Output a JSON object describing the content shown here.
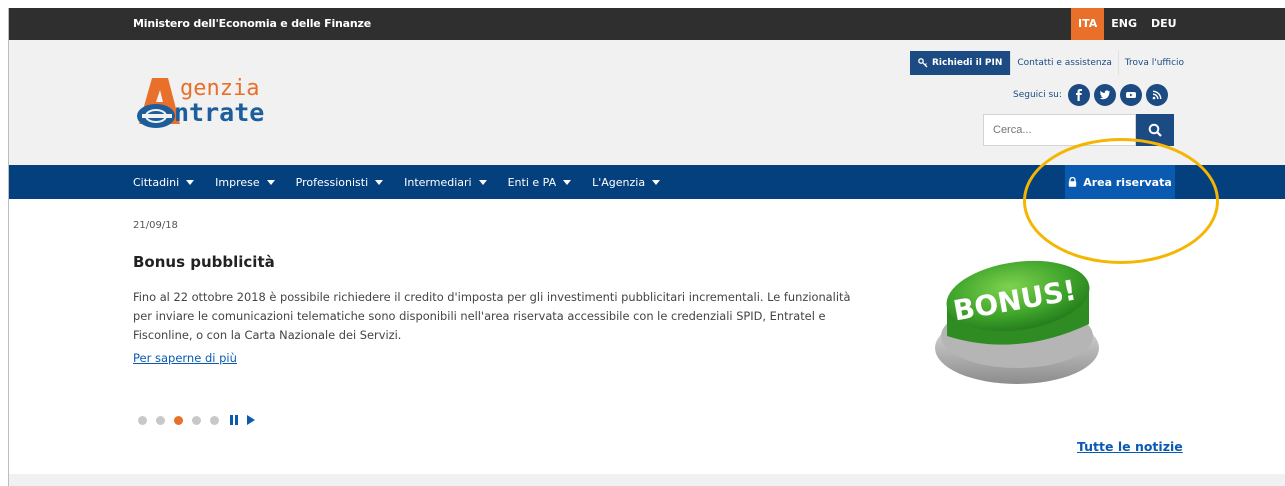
{
  "topbar": {
    "ministry": "Ministero dell'Economia e delle Finanze",
    "languages": [
      {
        "label": "ITA",
        "active": true
      },
      {
        "label": "ENG",
        "active": false
      },
      {
        "label": "DEU",
        "active": false
      }
    ]
  },
  "logo": {
    "line1": "genzia",
    "line2": "ntrate"
  },
  "utility": {
    "pin_label": "Richiedi il PIN",
    "contacts": "Contatti e assistenza",
    "office": "Trova l'ufficio"
  },
  "social": {
    "label": "Seguici su:",
    "icons": [
      "facebook-icon",
      "twitter-icon",
      "youtube-icon",
      "rss-icon"
    ]
  },
  "search": {
    "placeholder": "Cerca..."
  },
  "nav": {
    "items": [
      "Cittadini",
      "Imprese",
      "Professionisti",
      "Intermediari",
      "Enti e PA",
      "L'Agenzia"
    ],
    "area_riservata": "Area riservata"
  },
  "news": {
    "date": "21/09/18",
    "title": "Bonus pubblicità",
    "body": "Fino al 22 ottobre 2018 è possibile richiedere il credito d'imposta per gli investimenti pubblicitari incrementali. Le funzionalità per inviare le comunicazioni telematiche sono disponibili nell'area riservata accessibile con le credenziali SPID, Entratel e Fisconline, o con la Carta Nazionale dei Servizi.",
    "more": "Per saperne di più",
    "image_text": "BONUS!"
  },
  "carousel": {
    "total": 5,
    "active_index": 2
  },
  "footer_link": "Tutte le notizie",
  "colors": {
    "brand_blue": "#05407e",
    "accent_orange": "#e8702a",
    "highlight_yellow": "#f5b500"
  }
}
